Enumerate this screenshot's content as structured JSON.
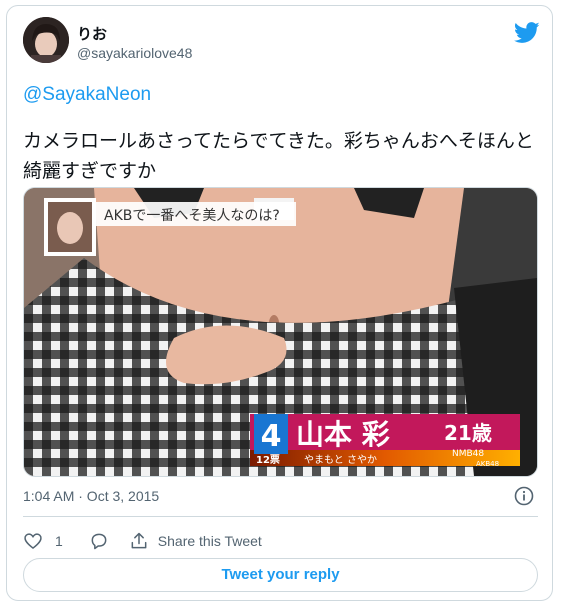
{
  "user": {
    "display_name": "りお",
    "handle": "@sayakariolove48",
    "avatar_icon": "avatar-photo"
  },
  "brand_icon": "twitter-bird-icon",
  "tweet": {
    "mention": "@SayakaNeon",
    "text": "カメラロールあさってたらでてきた。彩ちゃんおへそほんと綺麗すぎですか",
    "timestamp": "1:04 AM · Oct 3, 2015"
  },
  "media": {
    "caption": "AKBで一番へそ美人なのは?",
    "rank": "4",
    "votes": "12票",
    "name": "山本 彩",
    "age": "21歳",
    "reading": "やまもと さやか",
    "group": "NMB48",
    "subgroup": "AKB48"
  },
  "actions": {
    "like_count": "1",
    "share_label": "Share this Tweet",
    "reply_label": "Tweet your reply"
  },
  "colors": {
    "accent": "#1d9bf0",
    "muted": "#536471",
    "border": "#cfd9de"
  }
}
